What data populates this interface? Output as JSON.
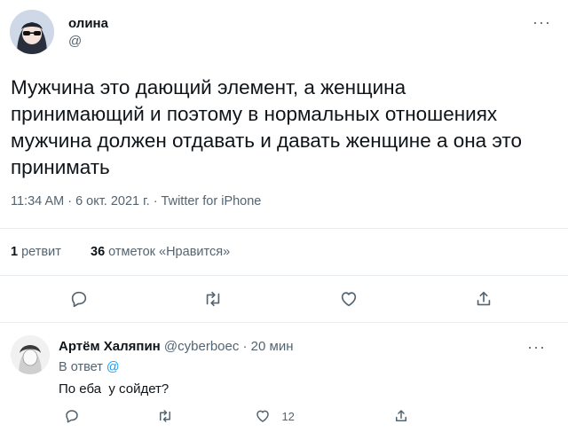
{
  "tweet": {
    "author_name": "олина",
    "author_handle": "@",
    "text": "Мужчина это дающий элемент, а женщина принимающий и поэтому в нормальных отношениях мужчина должен отдавать и давать женщине а она это принимать",
    "meta": "11:34 AM · 6 окт. 2021 г. · Twitter for iPhone",
    "stats": {
      "retweets_count": "1",
      "retweets_label": "ретвит",
      "likes_count": "36",
      "likes_label": "отметок «Нравится»"
    },
    "more_icon": "more-horizontal-icon"
  },
  "actions": {
    "icons": [
      "reply-icon",
      "retweet-icon",
      "like-icon",
      "share-icon"
    ]
  },
  "reply": {
    "author_name": "Артём Халяпин",
    "author_handle": "@cyberboec",
    "time": "· 20 мин",
    "in_reply_to": "В ответ",
    "in_reply_handle": "@",
    "text": "По еба  у сойдет?",
    "likes_count": "12"
  },
  "colors": {
    "text": "#0f1419",
    "muted": "#536471",
    "link": "#1d9bf0",
    "divider": "#e6ecf0"
  }
}
